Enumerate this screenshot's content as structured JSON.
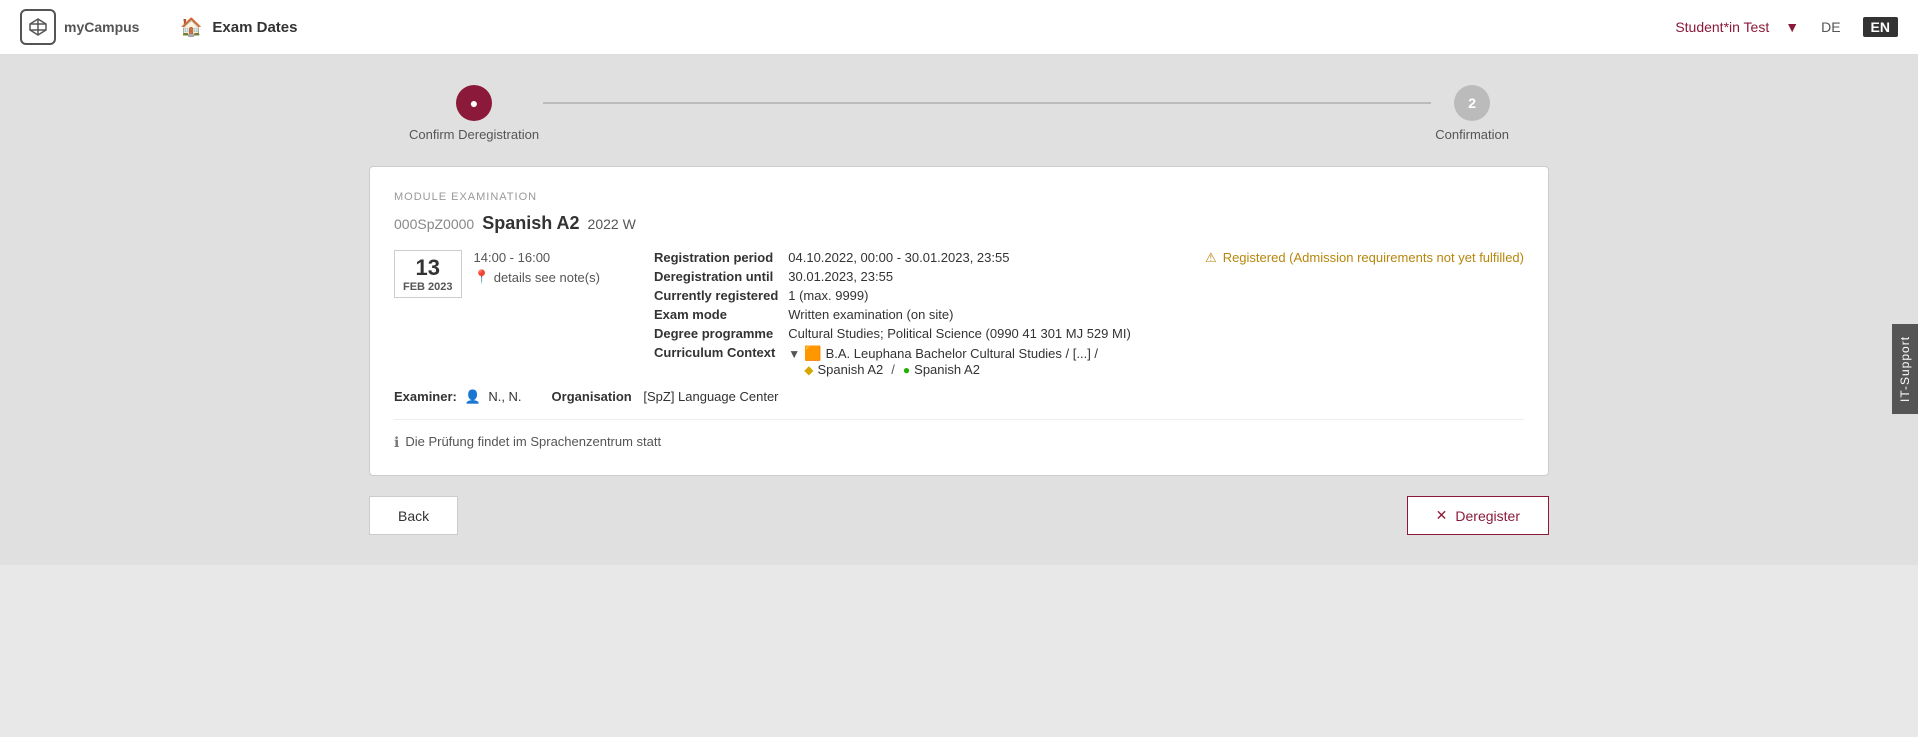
{
  "header": {
    "logo_text": "myCampus",
    "user_name": "Student*in Test",
    "lang_de": "DE",
    "lang_en": "EN",
    "nav_title": "Exam Dates"
  },
  "stepper": {
    "step1_label": "Confirm Deregistration",
    "step2_label": "Confirmation",
    "step2_number": "2"
  },
  "card": {
    "module_label": "MODULE EXAMINATION",
    "exam_code": "000SpZ0000",
    "exam_name": "Spanish A2",
    "exam_year": "2022 W",
    "date_day": "13",
    "date_month": "FEB 2023",
    "time": "14:00 - 16:00",
    "location": "details see note(s)",
    "registration_period_label": "Registration period",
    "registration_period_value": "04.10.2022, 00:00 - 30.01.2023, 23:55",
    "deregistration_until_label": "Deregistration until",
    "deregistration_until_value": "30.01.2023, 23:55",
    "currently_registered_label": "Currently registered",
    "currently_registered_value": "1 (max. 9999)",
    "exam_mode_label": "Exam mode",
    "exam_mode_value": "Written examination (on site)",
    "degree_programme_label": "Degree programme",
    "degree_programme_value": "Cultural Studies; Political Science (0990 41 301 MJ 529 MI)",
    "curriculum_context_label": "Curriculum Context",
    "curriculum_tree_line1": "B.A. Leuphana Bachelor Cultural Studies  /  [...]  /",
    "curriculum_tree_line2_diamond": "Spanish A2",
    "curriculum_tree_line2_circle": "Spanish A2",
    "status_text": "Registered (Admission requirements not yet fulfilled)",
    "examiner_label": "Examiner:",
    "examiner_value": "N., N.",
    "organisation_label": "Organisation",
    "organisation_value": "[SpZ] Language Center",
    "note_text": "Die Prüfung findet im Sprachenzentrum statt",
    "btn_back": "Back",
    "btn_deregister": "Deregister"
  },
  "it_support": "IT-Support"
}
